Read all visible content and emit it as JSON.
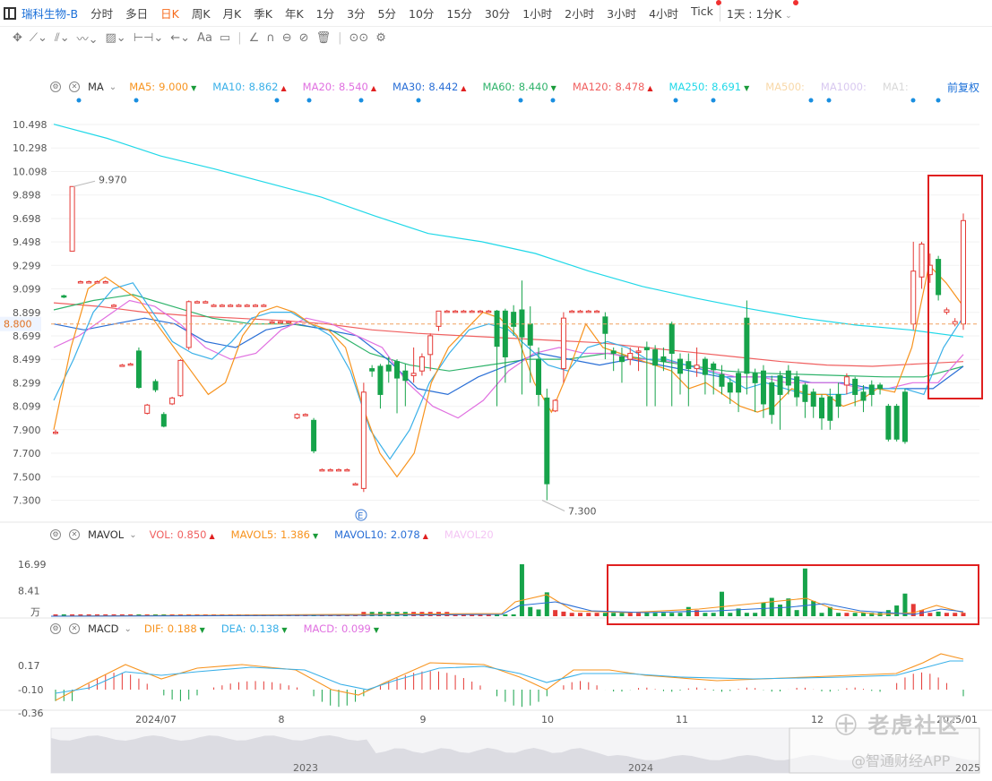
{
  "toolbar": {
    "stock_name": "瑞科生物-B",
    "periods": [
      "分时",
      "多日",
      "日K",
      "周K",
      "月K",
      "季K",
      "年K",
      "1分",
      "3分",
      "5分",
      "10分",
      "15分",
      "30分",
      "1小时",
      "2小时",
      "3小时",
      "4小时",
      "Tick"
    ],
    "active_period": "日K",
    "custom_period": "1天 : 1分K",
    "drawing_tools": [
      "move-icon",
      "line-icon",
      "channel-icon",
      "wave-icon",
      "fib-icon",
      "measure-icon",
      "arrow-icon",
      "text-tool-icon",
      "comment-icon",
      "ruler-icon",
      "magnet-icon",
      "lock-icon",
      "hide-icon",
      "trash-icon",
      "link-icon",
      "settings-icon"
    ],
    "text_tool_label": "Aa"
  },
  "main_legend": {
    "name": "MA",
    "items": [
      {
        "label": "MA5:",
        "value": "9.000",
        "color": "#f7931e",
        "arrow": "down"
      },
      {
        "label": "MA10:",
        "value": "8.862",
        "color": "#3ab0e8",
        "arrow": "up"
      },
      {
        "label": "MA20:",
        "value": "8.540",
        "color": "#e070e0",
        "arrow": "up"
      },
      {
        "label": "MA30:",
        "value": "8.442",
        "color": "#2a6fd6",
        "arrow": "up"
      },
      {
        "label": "MA60:",
        "value": "8.440",
        "color": "#2fb36b",
        "arrow": "down"
      },
      {
        "label": "MA120:",
        "value": "8.478",
        "color": "#f06060",
        "arrow": "up"
      },
      {
        "label": "MA250:",
        "value": "8.691",
        "color": "#20d8e8",
        "arrow": "down"
      },
      {
        "label": "MA500:",
        "value": "",
        "color": "#f8d8a8",
        "arrow": ""
      },
      {
        "label": "MA1000:",
        "value": "",
        "color": "#d8c8f0",
        "arrow": ""
      },
      {
        "label": "MA1:",
        "value": "",
        "color": "#d8d8d8",
        "arrow": ""
      }
    ],
    "adjust_label": "前复权"
  },
  "vol_legend": {
    "name": "MAVOL",
    "items": [
      {
        "label": "VOL:",
        "value": "0.850",
        "color": "#f06060",
        "arrow": "up"
      },
      {
        "label": "MAVOL5:",
        "value": "1.386",
        "color": "#f7931e",
        "arrow": "down"
      },
      {
        "label": "MAVOL10:",
        "value": "2.078",
        "color": "#2a6fd6",
        "arrow": "up"
      },
      {
        "label": "MAVOL20",
        "value": "",
        "color": "#f4c6f4",
        "arrow": ""
      }
    ]
  },
  "macd_legend": {
    "name": "MACD",
    "items": [
      {
        "label": "DIF:",
        "value": "0.188",
        "color": "#f7931e",
        "arrow": "down"
      },
      {
        "label": "DEA:",
        "value": "0.138",
        "color": "#3ab0e8",
        "arrow": "down"
      },
      {
        "label": "MACD:",
        "value": "0.099",
        "color": "#e070e0",
        "arrow": "down"
      }
    ]
  },
  "chart_data": {
    "type": "candlestick",
    "price_ticks": [
      "10.498",
      "10.298",
      "10.098",
      "9.898",
      "9.698",
      "9.498",
      "9.299",
      "9.099",
      "8.899",
      "8.699",
      "8.499",
      "8.299",
      "8.099",
      "7.900",
      "7.700",
      "7.500",
      "7.300"
    ],
    "current_price_label": "8.800",
    "current_price": 8.8,
    "high_annotation": "9.970",
    "low_annotation": "7.300",
    "earnings_marker": "E",
    "x_labels": [
      "2024/07",
      "8",
      "9",
      "10",
      "11",
      "12",
      "2025/01"
    ],
    "candles": [
      {
        "o": 7.88,
        "c": 7.88,
        "h": 7.9,
        "l": 7.86
      },
      {
        "o": 9.04,
        "c": 9.03,
        "h": 9.05,
        "l": 9.02
      },
      {
        "o": 9.42,
        "c": 9.97,
        "h": 9.97,
        "l": 9.42
      },
      {
        "o": 9.16,
        "c": 9.16,
        "h": 9.17,
        "l": 9.15
      },
      {
        "o": 9.16,
        "c": 9.16,
        "h": 9.17,
        "l": 9.15
      },
      {
        "o": 9.16,
        "c": 9.16,
        "h": 9.17,
        "l": 9.15
      },
      {
        "o": 9.16,
        "c": 9.16,
        "h": 9.17,
        "l": 9.15
      },
      {
        "o": 8.96,
        "c": 8.96,
        "h": 8.97,
        "l": 8.95
      },
      {
        "o": 8.45,
        "c": 8.45,
        "h": 8.46,
        "l": 8.44
      },
      {
        "o": 8.46,
        "c": 8.46,
        "h": 8.47,
        "l": 8.45
      },
      {
        "o": 8.57,
        "c": 8.26,
        "h": 8.6,
        "l": 8.25
      },
      {
        "o": 8.04,
        "c": 8.11,
        "h": 8.12,
        "l": 8.03
      },
      {
        "o": 8.31,
        "c": 8.24,
        "h": 8.33,
        "l": 8.22
      },
      {
        "o": 8.03,
        "c": 7.93,
        "h": 8.05,
        "l": 7.92
      },
      {
        "o": 8.12,
        "c": 8.17,
        "h": 8.18,
        "l": 8.11
      },
      {
        "o": 8.19,
        "c": 8.49,
        "h": 8.5,
        "l": 8.18
      },
      {
        "o": 8.6,
        "c": 8.99,
        "h": 9.0,
        "l": 8.58
      },
      {
        "o": 8.99,
        "c": 8.99,
        "h": 9.0,
        "l": 8.98
      },
      {
        "o": 8.99,
        "c": 8.99,
        "h": 9.0,
        "l": 8.98
      },
      {
        "o": 8.96,
        "c": 8.96,
        "h": 8.97,
        "l": 8.95
      },
      {
        "o": 8.96,
        "c": 8.96,
        "h": 8.97,
        "l": 8.95
      },
      {
        "o": 8.96,
        "c": 8.96,
        "h": 8.97,
        "l": 8.95
      },
      {
        "o": 8.96,
        "c": 8.96,
        "h": 8.97,
        "l": 8.95
      },
      {
        "o": 8.96,
        "c": 8.96,
        "h": 8.97,
        "l": 8.95
      },
      {
        "o": 8.96,
        "c": 8.96,
        "h": 8.97,
        "l": 8.95
      },
      {
        "o": 8.96,
        "c": 8.96,
        "h": 8.97,
        "l": 8.95
      },
      {
        "o": 8.82,
        "c": 8.82,
        "h": 8.83,
        "l": 8.81
      },
      {
        "o": 8.82,
        "c": 8.82,
        "h": 8.83,
        "l": 8.81
      },
      {
        "o": 8.82,
        "c": 8.82,
        "h": 8.83,
        "l": 8.81
      },
      {
        "o": 8.0,
        "c": 8.03,
        "h": 8.04,
        "l": 7.99
      },
      {
        "o": 8.03,
        "c": 8.03,
        "h": 8.04,
        "l": 8.02
      },
      {
        "o": 7.98,
        "c": 7.72,
        "h": 8.0,
        "l": 7.7
      },
      {
        "o": 7.56,
        "c": 7.56,
        "h": 7.57,
        "l": 7.55
      },
      {
        "o": 7.56,
        "c": 7.56,
        "h": 7.57,
        "l": 7.55
      },
      {
        "o": 7.56,
        "c": 7.56,
        "h": 7.57,
        "l": 7.55
      },
      {
        "o": 7.56,
        "c": 7.56,
        "h": 7.57,
        "l": 7.55
      },
      {
        "o": 7.44,
        "c": 7.44,
        "h": 7.45,
        "l": 7.43
      },
      {
        "o": 7.4,
        "c": 8.22,
        "h": 8.3,
        "l": 7.37
      },
      {
        "o": 8.42,
        "c": 8.4,
        "h": 8.45,
        "l": 8.35
      },
      {
        "o": 8.44,
        "c": 8.2,
        "h": 8.46,
        "l": 8.08
      },
      {
        "o": 8.45,
        "c": 8.4,
        "h": 8.52,
        "l": 8.3
      },
      {
        "o": 8.48,
        "c": 8.34,
        "h": 8.5,
        "l": 8.04
      },
      {
        "o": 8.4,
        "c": 8.32,
        "h": 8.46,
        "l": 8.1
      },
      {
        "o": 8.36,
        "c": 8.38,
        "h": 8.6,
        "l": 8.3
      },
      {
        "o": 8.4,
        "c": 8.52,
        "h": 8.55,
        "l": 8.36
      },
      {
        "o": 8.54,
        "c": 8.7,
        "h": 8.72,
        "l": 8.4
      },
      {
        "o": 8.78,
        "c": 8.91,
        "h": 8.91,
        "l": 8.74
      },
      {
        "o": 8.91,
        "c": 8.91,
        "h": 8.92,
        "l": 8.9
      },
      {
        "o": 8.91,
        "c": 8.91,
        "h": 8.92,
        "l": 8.9
      },
      {
        "o": 8.91,
        "c": 8.91,
        "h": 8.92,
        "l": 8.9
      },
      {
        "o": 8.91,
        "c": 8.91,
        "h": 8.92,
        "l": 8.9
      },
      {
        "o": 8.91,
        "c": 8.91,
        "h": 8.92,
        "l": 8.9
      },
      {
        "o": 8.91,
        "c": 8.91,
        "h": 8.92,
        "l": 8.9
      },
      {
        "o": 8.91,
        "c": 8.61,
        "h": 8.92,
        "l": 8.1
      },
      {
        "o": 8.91,
        "c": 8.52,
        "h": 8.93,
        "l": 8.3
      },
      {
        "o": 8.9,
        "c": 8.78,
        "h": 8.96,
        "l": 8.7
      },
      {
        "o": 8.92,
        "c": 8.69,
        "h": 9.17,
        "l": 8.2
      },
      {
        "o": 8.8,
        "c": 8.62,
        "h": 8.95,
        "l": 8.3
      },
      {
        "o": 8.5,
        "c": 8.2,
        "h": 8.6,
        "l": 8.1
      },
      {
        "o": 8.17,
        "c": 7.44,
        "h": 8.25,
        "l": 7.3
      },
      {
        "o": 8.06,
        "c": 8.15,
        "h": 8.16,
        "l": 8.05
      },
      {
        "o": 8.42,
        "c": 8.85,
        "h": 8.9,
        "l": 8.3
      },
      {
        "o": 8.91,
        "c": 8.91,
        "h": 8.92,
        "l": 8.9
      },
      {
        "o": 8.91,
        "c": 8.91,
        "h": 8.92,
        "l": 8.9
      },
      {
        "o": 8.91,
        "c": 8.91,
        "h": 8.92,
        "l": 8.9
      },
      {
        "o": 8.91,
        "c": 8.91,
        "h": 8.92,
        "l": 8.9
      },
      {
        "o": 8.86,
        "c": 8.72,
        "h": 8.9,
        "l": 8.5
      },
      {
        "o": 8.57,
        "c": 8.55,
        "h": 8.6,
        "l": 8.4
      },
      {
        "o": 8.52,
        "c": 8.48,
        "h": 8.6,
        "l": 8.3
      },
      {
        "o": 8.5,
        "c": 8.55,
        "h": 8.6,
        "l": 8.45
      },
      {
        "o": 8.56,
        "c": 8.57,
        "h": 8.6,
        "l": 8.4
      },
      {
        "o": 8.6,
        "c": 8.58,
        "h": 8.65,
        "l": 8.1
      },
      {
        "o": 8.58,
        "c": 8.45,
        "h": 8.62,
        "l": 8.1
      },
      {
        "o": 8.52,
        "c": 8.48,
        "h": 8.6,
        "l": 8.4
      },
      {
        "o": 8.8,
        "c": 8.55,
        "h": 8.82,
        "l": 8.1
      },
      {
        "o": 8.5,
        "c": 8.38,
        "h": 8.55,
        "l": 8.2
      },
      {
        "o": 8.48,
        "c": 8.42,
        "h": 8.55,
        "l": 8.1
      },
      {
        "o": 8.42,
        "c": 8.45,
        "h": 8.6,
        "l": 8.35
      },
      {
        "o": 8.5,
        "c": 8.37,
        "h": 8.52,
        "l": 8.2
      },
      {
        "o": 8.46,
        "c": 8.41,
        "h": 8.48,
        "l": 8.2
      },
      {
        "o": 8.37,
        "c": 8.27,
        "h": 8.45,
        "l": 8.2
      },
      {
        "o": 8.3,
        "c": 8.22,
        "h": 8.34,
        "l": 8.12
      },
      {
        "o": 8.38,
        "c": 8.22,
        "h": 8.42,
        "l": 8.05
      },
      {
        "o": 8.85,
        "c": 8.38,
        "h": 9.0,
        "l": 8.2
      },
      {
        "o": 8.38,
        "c": 8.3,
        "h": 8.42,
        "l": 8.05
      },
      {
        "o": 8.4,
        "c": 8.12,
        "h": 8.45,
        "l": 8.0
      },
      {
        "o": 8.3,
        "c": 8.03,
        "h": 8.36,
        "l": 7.95
      },
      {
        "o": 8.36,
        "c": 8.2,
        "h": 8.4,
        "l": 7.9
      },
      {
        "o": 8.4,
        "c": 8.28,
        "h": 8.45,
        "l": 8.2
      },
      {
        "o": 8.35,
        "c": 8.18,
        "h": 8.4,
        "l": 8.1
      },
      {
        "o": 8.28,
        "c": 8.14,
        "h": 8.3,
        "l": 8.0
      },
      {
        "o": 8.22,
        "c": 8.1,
        "h": 8.25,
        "l": 8.0
      },
      {
        "o": 8.17,
        "c": 8.0,
        "h": 8.2,
        "l": 7.9
      },
      {
        "o": 8.18,
        "c": 7.98,
        "h": 8.25,
        "l": 7.9
      },
      {
        "o": 8.2,
        "c": 8.1,
        "h": 8.3,
        "l": 8.0
      },
      {
        "o": 8.28,
        "c": 8.35,
        "h": 8.38,
        "l": 8.2
      },
      {
        "o": 8.33,
        "c": 8.2,
        "h": 8.35,
        "l": 8.1
      },
      {
        "o": 8.22,
        "c": 8.15,
        "h": 8.28,
        "l": 8.05
      },
      {
        "o": 8.28,
        "c": 8.2,
        "h": 8.32,
        "l": 8.1
      },
      {
        "o": 8.28,
        "c": 8.25,
        "h": 8.3,
        "l": 8.2
      },
      {
        "o": 8.1,
        "c": 7.82,
        "h": 8.12,
        "l": 7.8
      },
      {
        "o": 8.1,
        "c": 7.82,
        "h": 8.12,
        "l": 7.8
      },
      {
        "o": 8.22,
        "c": 7.8,
        "h": 8.25,
        "l": 7.78
      },
      {
        "o": 8.8,
        "c": 9.25,
        "h": 9.5,
        "l": 8.75
      },
      {
        "o": 9.2,
        "c": 9.48,
        "h": 9.5,
        "l": 9.1
      },
      {
        "o": 9.22,
        "c": 9.3,
        "h": 9.4,
        "l": 9.15
      },
      {
        "o": 9.35,
        "c": 9.05,
        "h": 9.38,
        "l": 9.0
      },
      {
        "o": 8.9,
        "c": 8.92,
        "h": 8.94,
        "l": 8.88
      },
      {
        "o": 8.8,
        "c": 8.82,
        "h": 8.85,
        "l": 8.78
      },
      {
        "o": 8.8,
        "c": 9.68,
        "h": 9.74,
        "l": 8.75
      }
    ],
    "ma_series": [
      {
        "name": "MA5",
        "color": "#f7931e",
        "values": [
          7.9,
          8.6,
          9.1,
          9.2,
          9.1,
          9.0,
          8.8,
          8.6,
          8.4,
          8.2,
          8.3,
          8.7,
          8.9,
          8.95,
          8.9,
          8.8,
          8.75,
          8.6,
          8.1,
          7.7,
          7.5,
          7.7,
          8.3,
          8.6,
          8.75,
          8.9,
          8.85,
          8.7,
          8.3,
          8.05,
          8.4,
          8.8,
          8.6,
          8.55,
          8.5,
          8.45,
          8.4,
          8.25,
          8.3,
          8.2,
          8.1,
          8.05,
          8.1,
          8.25,
          8.2,
          8.2,
          8.1,
          8.15,
          8.25,
          8.22,
          8.6,
          9.3,
          9.15,
          8.95
        ]
      },
      {
        "name": "MA10",
        "color": "#3ab0e8",
        "values": [
          8.15,
          8.5,
          8.9,
          9.1,
          9.15,
          8.9,
          8.65,
          8.55,
          8.5,
          8.65,
          8.85,
          8.9,
          8.9,
          8.8,
          8.7,
          8.4,
          7.9,
          7.65,
          7.9,
          8.3,
          8.55,
          8.75,
          8.8,
          8.75,
          8.6,
          8.45,
          8.4,
          8.6,
          8.65,
          8.6,
          8.5,
          8.5,
          8.45,
          8.4,
          8.35,
          8.25,
          8.3,
          8.25,
          8.2,
          8.2,
          8.2,
          8.25,
          8.25,
          8.25,
          8.2,
          8.6,
          8.86
        ]
      },
      {
        "name": "MA20",
        "color": "#e070e0",
        "values": [
          8.6,
          8.7,
          8.85,
          9.0,
          8.95,
          8.8,
          8.6,
          8.5,
          8.55,
          8.75,
          8.85,
          8.8,
          8.7,
          8.6,
          8.3,
          8.1,
          8.0,
          8.15,
          8.4,
          8.55,
          8.6,
          8.55,
          8.55,
          8.5,
          8.5,
          8.45,
          8.4,
          8.35,
          8.35,
          8.3,
          8.3,
          8.3,
          8.25,
          8.25,
          8.3,
          8.3,
          8.54
        ]
      },
      {
        "name": "MA30",
        "color": "#2a6fd6",
        "values": [
          8.8,
          8.75,
          8.8,
          8.85,
          8.8,
          8.65,
          8.6,
          8.75,
          8.8,
          8.75,
          8.7,
          8.5,
          8.25,
          8.2,
          8.35,
          8.45,
          8.55,
          8.5,
          8.45,
          8.5,
          8.45,
          8.4,
          8.35,
          8.35,
          8.35,
          8.3,
          8.3,
          8.25,
          8.25,
          8.25,
          8.44
        ]
      },
      {
        "name": "MA60",
        "color": "#2fb36b",
        "values": [
          8.92,
          9.0,
          9.05,
          8.95,
          8.85,
          8.8,
          8.8,
          8.75,
          8.55,
          8.45,
          8.4,
          8.45,
          8.5,
          8.5,
          8.55,
          8.5,
          8.45,
          8.4,
          8.38,
          8.37,
          8.36,
          8.35,
          8.35,
          8.44
        ]
      },
      {
        "name": "MA120",
        "color": "#f06060",
        "values": [
          8.98,
          8.95,
          8.9,
          8.87,
          8.85,
          8.83,
          8.8,
          8.75,
          8.72,
          8.7,
          8.68,
          8.66,
          8.64,
          8.6,
          8.56,
          8.52,
          8.48,
          8.45,
          8.44,
          8.46,
          8.48
        ]
      },
      {
        "name": "MA250",
        "color": "#20d8e8",
        "values": [
          10.5,
          10.38,
          10.23,
          10.12,
          10.0,
          9.88,
          9.72,
          9.57,
          9.5,
          9.4,
          9.25,
          9.12,
          9.02,
          8.93,
          8.85,
          8.79,
          8.75,
          8.69
        ]
      }
    ],
    "volume_ticks": [
      "16.99",
      "8.41",
      "万"
    ],
    "volume_unit": "万",
    "macd_ticks": [
      "0.17",
      "-0.10",
      "-0.36"
    ],
    "navigator_labels": [
      "2023",
      "2024",
      "2025"
    ]
  }
}
